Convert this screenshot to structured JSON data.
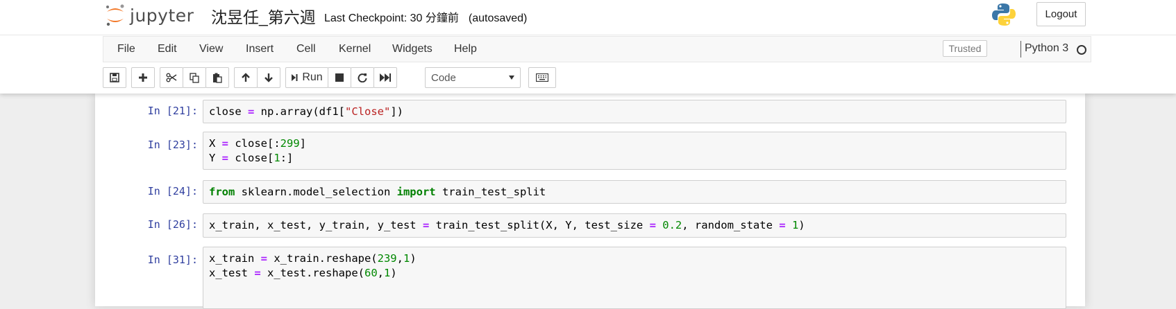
{
  "header": {
    "logo_text": "jupyter",
    "notebook_name": "沈昱任_第六週",
    "checkpoint": "Last Checkpoint: 30 分鐘前",
    "autosave": "(autosaved)",
    "logout_label": "Logout"
  },
  "menubar": {
    "items": [
      "File",
      "Edit",
      "View",
      "Insert",
      "Cell",
      "Kernel",
      "Widgets",
      "Help"
    ],
    "trusted_label": "Trusted",
    "kernel_name": "Python 3"
  },
  "toolbar": {
    "run_label": "Run",
    "cell_type": "Code",
    "icons": [
      "save-icon",
      "plus-icon",
      "cut-icon",
      "copy-icon",
      "paste-icon",
      "arrow-up-icon",
      "arrow-down-icon",
      "step-forward-icon",
      "stop-icon",
      "restart-icon",
      "fast-forward-icon",
      "keyboard-icon"
    ]
  },
  "cells": [
    {
      "prompt": "In [21]:",
      "code": "close = np.array(df1[\"Close\"])"
    },
    {
      "prompt": "In [23]:",
      "code": "X = close[:299]\nY = close[1:]"
    },
    {
      "prompt": "In [24]:",
      "code": "from sklearn.model_selection import train_test_split"
    },
    {
      "prompt": "In [26]:",
      "code": "x_train, x_test, y_train, y_test = train_test_split(X, Y, test_size = 0.2, random_state = 1)"
    },
    {
      "prompt": "In [31]:",
      "code": "x_train = x_train.reshape(239,1)\nx_test = x_test.reshape(60,1)"
    }
  ],
  "colors": {
    "prompt": "#303f9f",
    "keyword": "#008000",
    "operator": "#aa22ff",
    "number": "#008800",
    "string": "#ba2121",
    "logo_orange": "#f37726"
  }
}
